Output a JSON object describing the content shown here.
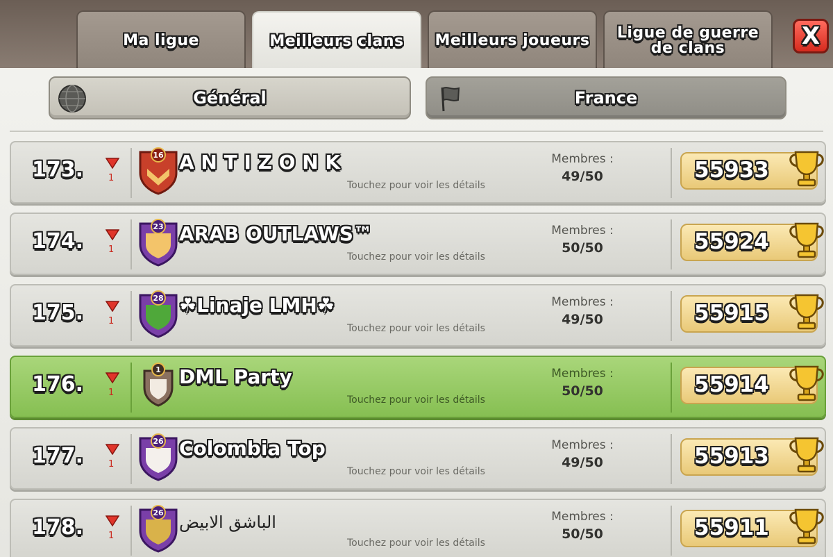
{
  "tabs": [
    {
      "label": "Ma ligue"
    },
    {
      "label": "Meilleurs clans"
    },
    {
      "label": "Meilleurs joueurs"
    },
    {
      "label": "Ligue de guerre de clans"
    }
  ],
  "close_label": "X",
  "filters": {
    "global": "Général",
    "local": "France"
  },
  "rows": [
    {
      "rank": "173.",
      "trend": "1",
      "level": "16",
      "name": "A N T I Z O N K",
      "hint": "Touchez pour voir les détails",
      "members_label": "Membres :",
      "members": "49/50",
      "trophies": "55933"
    },
    {
      "rank": "174.",
      "trend": "1",
      "level": "23",
      "name": "ARAB OUTLAWS™",
      "hint": "Touchez pour voir les détails",
      "members_label": "Membres :",
      "members": "50/50",
      "trophies": "55924"
    },
    {
      "rank": "175.",
      "trend": "1",
      "level": "28",
      "name": "☘Linaje LMH☘",
      "hint": "Touchez pour voir les détails",
      "members_label": "Membres :",
      "members": "49/50",
      "trophies": "55915"
    },
    {
      "rank": "176.",
      "trend": "1",
      "level": "1",
      "name": "DML Party",
      "hint": "Touchez pour voir les détails",
      "members_label": "Membres :",
      "members": "50/50",
      "trophies": "55914"
    },
    {
      "rank": "177.",
      "trend": "1",
      "level": "26",
      "name": "Colombia Top",
      "hint": "Touchez pour voir les détails",
      "members_label": "Membres :",
      "members": "49/50",
      "trophies": "55913"
    },
    {
      "rank": "178.",
      "trend": "1",
      "level": "26",
      "name": "الباشق الابيض",
      "hint": "Touchez pour voir les détails",
      "members_label": "Membres :",
      "members": "50/50",
      "trophies": "55911"
    }
  ],
  "colors": {
    "highlight_row": "#86bf52",
    "trend_down": "#e0352a",
    "trophy_box": "#e9c978",
    "close_button": "#d62b1e"
  }
}
